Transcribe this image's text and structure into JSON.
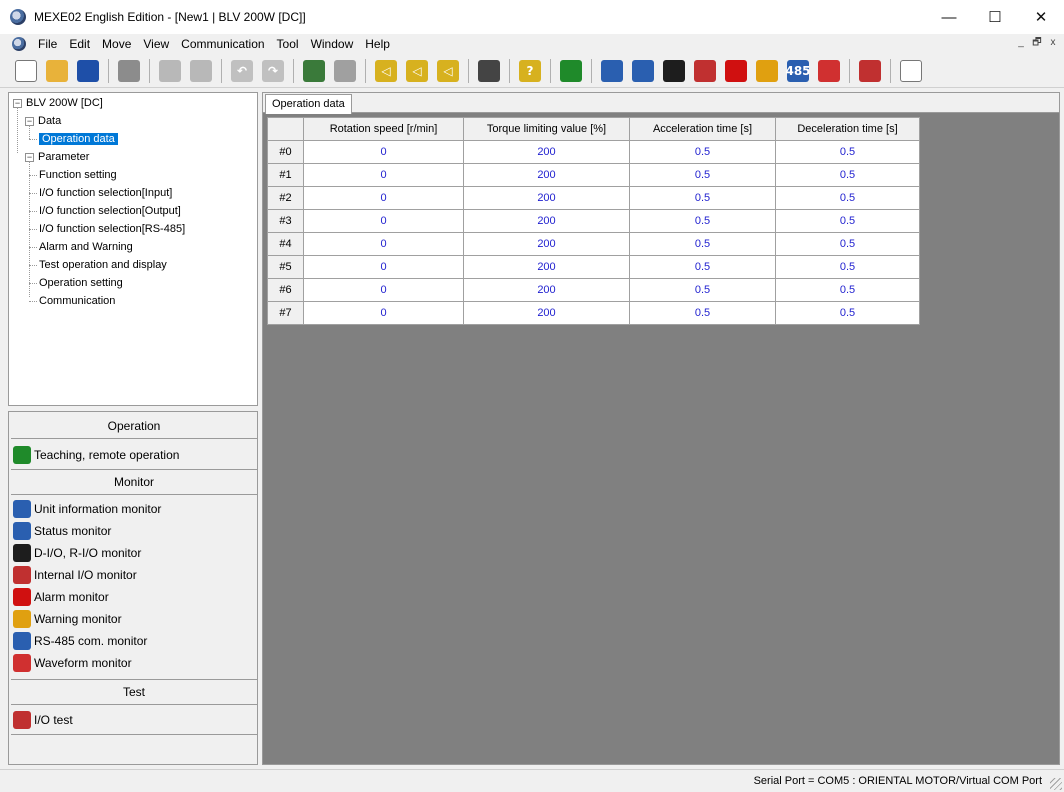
{
  "window": {
    "title": "MEXE02 English Edition - [New1 | BLV 200W [DC]]",
    "minimize": "—",
    "maximize": "☐",
    "close": "✕"
  },
  "menu": [
    "File",
    "Edit",
    "Move",
    "View",
    "Communication",
    "Tool",
    "Window",
    "Help"
  ],
  "mdi_controls": [
    "_",
    "🗗",
    "x"
  ],
  "toolbar": {
    "buttons": [
      {
        "name": "new-icon",
        "glyph": "",
        "color": "#ffffff"
      },
      {
        "name": "open-icon",
        "glyph": "",
        "color": "#e8b23a"
      },
      {
        "name": "save-icon",
        "glyph": "",
        "color": "#1e4fa8"
      },
      {
        "name": "print-icon",
        "glyph": "",
        "color": "#8c8c8c"
      },
      {
        "name": "copy-icon",
        "glyph": "",
        "color": "#b8b8b8"
      },
      {
        "name": "paste-icon",
        "glyph": "",
        "color": "#b8b8b8"
      },
      {
        "name": "undo-icon",
        "glyph": "↶",
        "color": "#c0c0c0"
      },
      {
        "name": "redo-icon",
        "glyph": "↷",
        "color": "#c0c0c0"
      },
      {
        "name": "communication-connect-icon",
        "glyph": "",
        "color": "#3a7a3a"
      },
      {
        "name": "communication-disconnect-icon",
        "glyph": "",
        "color": "#a0a0a0"
      },
      {
        "name": "upload-icon",
        "glyph": "◁",
        "color": "#d7b11f"
      },
      {
        "name": "download-icon",
        "glyph": "◁",
        "color": "#d7b11f"
      },
      {
        "name": "verify-icon",
        "glyph": "◁",
        "color": "#d7b11f"
      },
      {
        "name": "parameter-icon",
        "glyph": "",
        "color": "#444444"
      },
      {
        "name": "data-check-icon",
        "glyph": "?",
        "color": "#d7b11f"
      },
      {
        "name": "teaching-icon",
        "glyph": "",
        "color": "#1f8a2a"
      },
      {
        "name": "unit-info-monitor-icon",
        "glyph": "",
        "color": "#2a5fb0"
      },
      {
        "name": "status-monitor-icon",
        "glyph": "",
        "color": "#2a5fb0"
      },
      {
        "name": "io-monitor-icon",
        "glyph": "",
        "color": "#1d1d1d"
      },
      {
        "name": "internal-io-monitor-icon",
        "glyph": "",
        "color": "#c03030"
      },
      {
        "name": "alarm-monitor-icon",
        "glyph": "",
        "color": "#d01010"
      },
      {
        "name": "warning-monitor-icon",
        "glyph": "",
        "color": "#e0a010"
      },
      {
        "name": "rs485-monitor-icon",
        "glyph": "485",
        "color": "#2a5fb0"
      },
      {
        "name": "waveform-monitor-icon",
        "glyph": "",
        "color": "#d03030"
      },
      {
        "name": "io-test-icon",
        "glyph": "",
        "color": "#c03030"
      },
      {
        "name": "layout-icon",
        "glyph": "",
        "color": "#ffffff"
      }
    ]
  },
  "tree": {
    "root": "BLV 200W [DC]",
    "data_label": "Data",
    "operation_data": "Operation data",
    "parameter_label": "Parameter",
    "parameter_items": [
      "Function setting",
      "I/O function selection[Input]",
      "I/O function selection[Output]",
      "I/O function selection[RS-485]",
      "Alarm and Warning",
      "Test operation and display",
      "Operation setting",
      "Communication"
    ]
  },
  "panel": {
    "operation_header": "Operation",
    "teaching": "Teaching, remote operation",
    "monitor_header": "Monitor",
    "monitor_items": [
      {
        "label": "Unit information monitor",
        "icon": "unit-info-monitor-icon",
        "glyph": "",
        "color": "#2a5fb0"
      },
      {
        "label": "Status monitor",
        "icon": "status-monitor-icon",
        "glyph": "",
        "color": "#2a5fb0"
      },
      {
        "label": "D-I/O, R-I/O monitor",
        "icon": "io-monitor-icon",
        "glyph": "",
        "color": "#1d1d1d"
      },
      {
        "label": "Internal I/O monitor",
        "icon": "internal-io-monitor-icon",
        "glyph": "",
        "color": "#c03030"
      },
      {
        "label": "Alarm monitor",
        "icon": "alarm-monitor-icon",
        "glyph": "",
        "color": "#d01010"
      },
      {
        "label": "Warning monitor",
        "icon": "warning-monitor-icon",
        "glyph": "",
        "color": "#e0a010"
      },
      {
        "label": "RS-485 com. monitor",
        "icon": "rs485-monitor-icon",
        "glyph": "",
        "color": "#2a5fb0"
      },
      {
        "label": "Waveform monitor",
        "icon": "waveform-monitor-icon",
        "glyph": "",
        "color": "#d03030"
      }
    ],
    "test_header": "Test",
    "io_test": "I/O test"
  },
  "document": {
    "tab": "Operation data",
    "columns": [
      "",
      "Rotation speed [r/min]",
      "Torque limiting value [%]",
      "Acceleration time [s]",
      "Deceleration time [s]"
    ],
    "rows": [
      [
        "#0",
        "0",
        "200",
        "0.5",
        "0.5"
      ],
      [
        "#1",
        "0",
        "200",
        "0.5",
        "0.5"
      ],
      [
        "#2",
        "0",
        "200",
        "0.5",
        "0.5"
      ],
      [
        "#3",
        "0",
        "200",
        "0.5",
        "0.5"
      ],
      [
        "#4",
        "0",
        "200",
        "0.5",
        "0.5"
      ],
      [
        "#5",
        "0",
        "200",
        "0.5",
        "0.5"
      ],
      [
        "#6",
        "0",
        "200",
        "0.5",
        "0.5"
      ],
      [
        "#7",
        "0",
        "200",
        "0.5",
        "0.5"
      ]
    ]
  },
  "status": {
    "text": "Serial Port = COM5 : ORIENTAL MOTOR/Virtual COM Port"
  },
  "colors": {
    "value_text": "#1f1fcf",
    "selection": "#0078d7",
    "mdi_background": "#808080"
  }
}
